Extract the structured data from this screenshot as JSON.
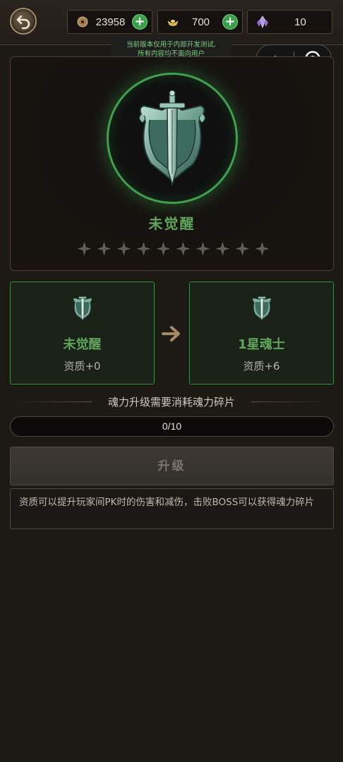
{
  "top_bar": {
    "coins": {
      "icon": "coin-icon",
      "value": "23958"
    },
    "ingots": {
      "icon": "gold-ingot-icon",
      "value": "700"
    },
    "crystals": {
      "icon": "crystal-icon",
      "value": "10"
    },
    "plus_label": "+"
  },
  "tooltip": {
    "line1": "当前版本仅用于内部开发测试,",
    "line2": "所有内容均不面向用户"
  },
  "hero": {
    "icon": "sword-shield-emblem-icon",
    "status": "未觉醒",
    "stars_total": 10,
    "stars_filled": 0
  },
  "compare": {
    "current": {
      "title": "未觉醒",
      "quality": "资质+0"
    },
    "next": {
      "title": "1星魂士",
      "quality": "资质+6"
    }
  },
  "requirement": {
    "label": "魂力升级需要消耗魂力碎片",
    "progress_text": "0/10",
    "progress_fraction": 0
  },
  "upgrade_button": {
    "label": "升级",
    "enabled": false
  },
  "description": "资质可以提升玩家间PK时的伤害和减伤，击败BOSS可以获得魂力碎片",
  "colors": {
    "accent_green": "#3fa14f",
    "title_green": "#5fa55c",
    "background": "#1d1915"
  }
}
